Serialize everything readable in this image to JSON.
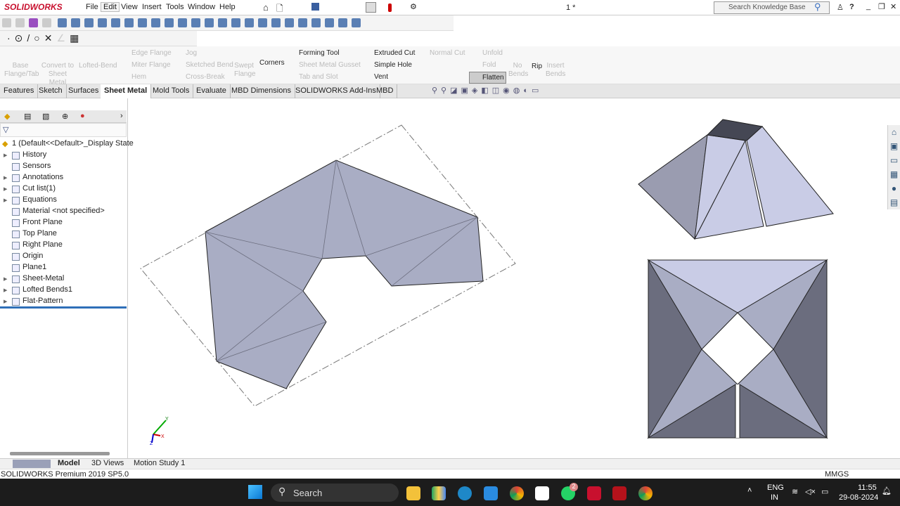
{
  "app": {
    "brand": "SOLIDWORKS",
    "doc_title": "1 *"
  },
  "menu": [
    "File",
    "Edit",
    "View",
    "Insert",
    "Tools",
    "Window",
    "Help"
  ],
  "search": {
    "placeholder": "Search Knowledge Base"
  },
  "ribbon": {
    "base_flange": "Base Flange/Tab",
    "convert": "Convert to Sheet Metal",
    "lofted": "Lofted-Bend",
    "edge_flange": "Edge Flange",
    "miter_flange": "Miter Flange",
    "hem": "Hem",
    "jog": "Jog",
    "sketched_bend": "Sketched Bend",
    "cross_break": "Cross-Break",
    "swept": "Swept Flange",
    "corners": "Corners",
    "forming": "Forming Tool",
    "gusset": "Sheet Metal Gusset",
    "tab_slot": "Tab and Slot",
    "extruded_cut": "Extruded Cut",
    "simple_hole": "Simple Hole",
    "vent": "Vent",
    "normal_cut": "Normal Cut",
    "unfold": "Unfold",
    "fold": "Fold",
    "flatten": "Flatten",
    "no_bends": "No Bends",
    "rip": "Rip",
    "insert_bends": "Insert Bends"
  },
  "tabs": [
    "Features",
    "Sketch",
    "Surfaces",
    "Sheet Metal",
    "Mold Tools",
    "Evaluate",
    "MBD Dimensions",
    "SOLIDWORKS Add-Ins",
    "MBD"
  ],
  "tree": {
    "root": "1  (Default<<Default>_Display State",
    "items": [
      "History",
      "Sensors",
      "Annotations",
      "Cut list(1)",
      "Equations",
      "Material <not specified>",
      "Front Plane",
      "Top Plane",
      "Right Plane",
      "Origin",
      "Plane1",
      "Sheet-Metal",
      "Lofted Bends1",
      "Flat-Pattern"
    ]
  },
  "bottom_tabs": [
    "Model",
    "3D Views",
    "Motion Study 1"
  ],
  "status": {
    "left": "SOLIDWORKS Premium 2019 SP5.0",
    "units": "MMGS"
  },
  "triad": {
    "x": "X",
    "y": "Y",
    "z": "Z"
  },
  "taskbar": {
    "search": "Search",
    "lang1": "ENG",
    "lang2": "IN",
    "time": "11:55",
    "date": "29-08-2024",
    "whatsapp_badge": "2"
  },
  "colors": {
    "face": "#a9adc4",
    "face_light": "#c9cce6",
    "face_dark": "#6b6d7e",
    "accent": "#c8102e"
  }
}
